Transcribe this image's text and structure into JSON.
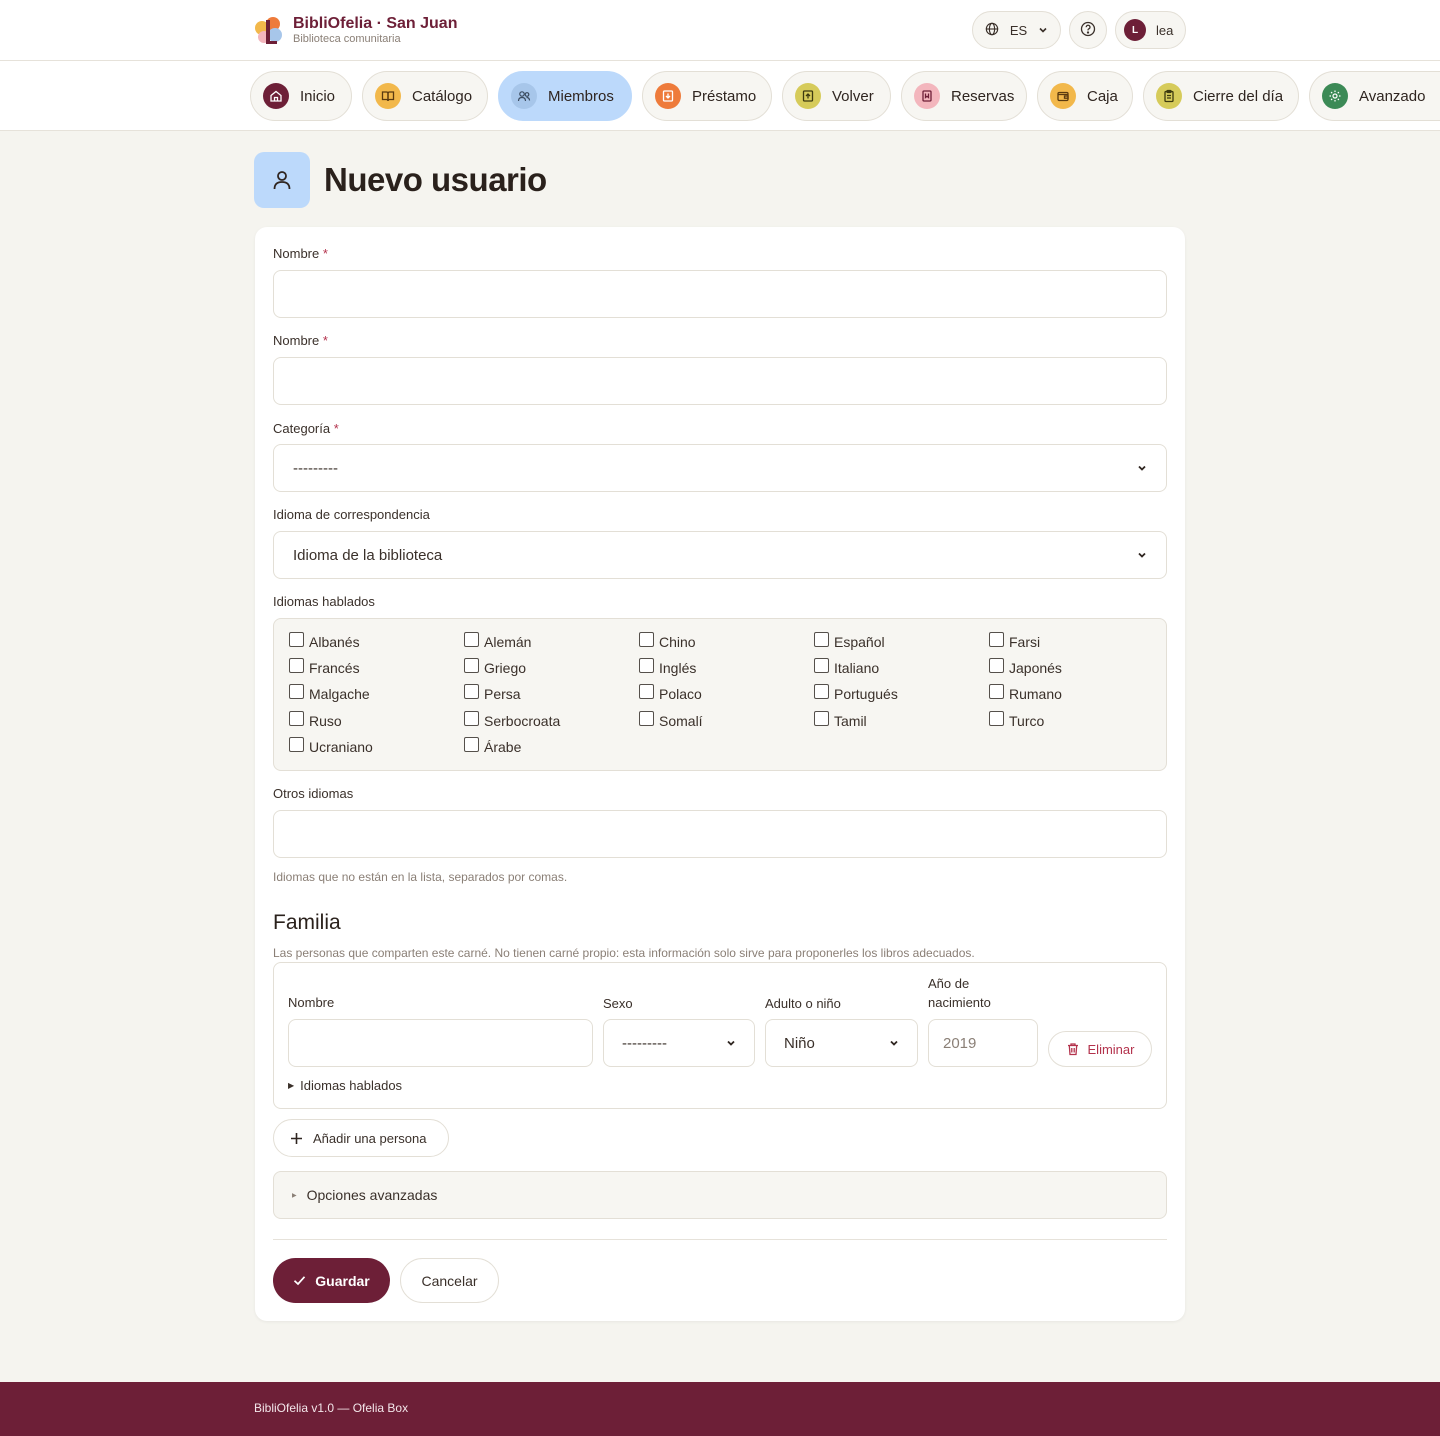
{
  "header": {
    "brand_title": "BibliOfelia · San Juan",
    "brand_subtitle": "Biblioteca comunitaria",
    "language": "ES",
    "user_initial": "L",
    "user_name": "lea"
  },
  "nav": {
    "tabs": [
      {
        "label": "Inicio",
        "icon": "home-icon",
        "color": "#6d1f37"
      },
      {
        "label": "Catálogo",
        "icon": "book-icon",
        "color": "#f2b84b"
      },
      {
        "label": "Miembros",
        "icon": "users-icon",
        "color": "#a7c6ea",
        "active": true
      },
      {
        "label": "Préstamo",
        "icon": "loan-icon",
        "color": "#ee7b3b"
      },
      {
        "label": "Volver",
        "icon": "return-icon",
        "color": "#d6cb5a"
      },
      {
        "label": "Reservas",
        "icon": "bookmark-icon",
        "color": "#f3b6bd"
      },
      {
        "label": "Caja",
        "icon": "wallet-icon",
        "color": "#f2b84b"
      },
      {
        "label": "Cierre del día",
        "icon": "clipboard-icon",
        "color": "#d6cb5a"
      },
      {
        "label": "Avanzado",
        "icon": "gear-icon",
        "color": "#3c8a56"
      }
    ]
  },
  "page": {
    "title": "Nuevo usuario"
  },
  "form": {
    "field1_label": "Nombre",
    "field2_label": "Nombre",
    "required_mark": "*",
    "category_label": "Categoría",
    "category_value": "---------",
    "corr_lang_label": "Idioma de correspondencia",
    "corr_lang_value": "Idioma de la biblioteca",
    "spoken_label": "Idiomas hablados",
    "languages": [
      "Albanés",
      "Alemán",
      "Chino",
      "Español",
      "Farsi",
      "Francés",
      "Griego",
      "Inglés",
      "Italiano",
      "Japonés",
      "Malgache",
      "Persa",
      "Polaco",
      "Portugués",
      "Rumano",
      "Ruso",
      "Serbocroata",
      "Somalí",
      "Tamil",
      "Turco",
      "Ucraniano",
      "Árabe"
    ],
    "other_label": "Otros idiomas",
    "other_help": "Idiomas que no están en la lista, separados por comas."
  },
  "family": {
    "title": "Familia",
    "help": "Las personas que comparten este carné. No tienen carné propio: esta información solo sirve para proponerles los libros adecuados.",
    "col_name": "Nombre",
    "col_sex": "Sexo",
    "col_age": "Adulto o niño",
    "col_year_1": "Año de",
    "col_year_2": "nacimiento",
    "sex_value": "---------",
    "age_value": "Niño",
    "year_placeholder": "2019",
    "delete_label": "Eliminar",
    "spoken_summary": "Idiomas hablados",
    "add_label": "Añadir una persona"
  },
  "advanced": {
    "label": "Opciones avanzadas"
  },
  "actions": {
    "save": "Guardar",
    "cancel": "Cancelar"
  },
  "footer": {
    "text": "BibliOfelia v1.0 — Ofelia Box"
  }
}
